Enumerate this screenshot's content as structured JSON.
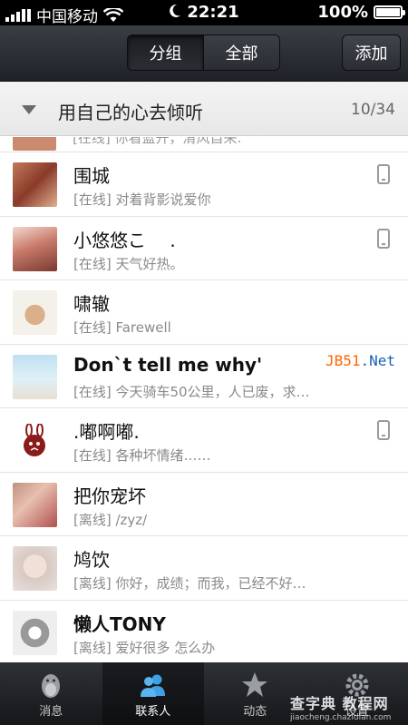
{
  "status_bar": {
    "carrier": "中国移动",
    "time": "22:21",
    "battery": "100%",
    "battery_level": 1.0
  },
  "nav": {
    "segments": [
      "分组",
      "全部"
    ],
    "active_segment": 0,
    "add_label": "添加"
  },
  "group": {
    "title": "用自己的心去倾听",
    "count": "10/34"
  },
  "partial_row": {
    "status": "[在线] 你看蓝开，清风自来."
  },
  "contacts": [
    {
      "name": "围城",
      "status": "[在线] 对着背影说爱你",
      "device": "phone"
    },
    {
      "name": "小悠悠こ　 .",
      "status": "[在线] 天气好热。",
      "device": "phone"
    },
    {
      "name": "啸辙",
      "status": "[在线] Farewell",
      "device": ""
    },
    {
      "name": " Don`t tell me why'",
      "status": "[在线] 今天骑车50公里，人已废，求…",
      "device": ""
    },
    {
      "name": ".嘟啊嘟.",
      "status": "[在线] 各种坏情绪……",
      "device": "phone"
    },
    {
      "name": "把你宠坏",
      "status": "[离线]  /zyz/",
      "device": ""
    },
    {
      "name": "鸠饮",
      "status": "[离线] 你好，成绩；而我，已经不好…",
      "device": ""
    },
    {
      "name": "懒人TONY",
      "status": "[离线] 爱好很多 怎么办",
      "device": ""
    }
  ],
  "overlay": {
    "jb51_a": "JB51",
    "jb51_b": ".Net",
    "watermark": "查字典 教程网",
    "watermark_sub": "jiaocheng.chazidian.com"
  },
  "tabs": [
    {
      "label": "消息",
      "icon": "penguin-icon"
    },
    {
      "label": "联系人",
      "icon": "contacts-icon"
    },
    {
      "label": "动态",
      "icon": "star-icon"
    },
    {
      "label": "设置",
      "icon": "gear-icon"
    }
  ],
  "active_tab": 1,
  "colors": {
    "jb51_orange": "#ff6600",
    "jb51_blue": "#1a5fb4",
    "contacts_active": "#3fa0e6"
  }
}
